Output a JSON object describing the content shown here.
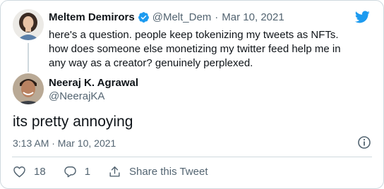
{
  "original_tweet": {
    "name": "Meltem Demirors",
    "handle": "@Melt_Dem",
    "separator": "·",
    "date": "Mar 10, 2021",
    "text_lines": [
      "here's a question. people keep tokenizing my tweets as NFTs.",
      "how does someone else monetizing my twitter feed help me in",
      "any way as a creator? genuinely perplexed."
    ]
  },
  "reply_tweet": {
    "name": "Neeraj K. Agrawal",
    "handle": "@NeerajKA",
    "text": "its pretty annoying",
    "timestamp": "3:13 AM · Mar 10, 2021"
  },
  "actions": {
    "likes": "18",
    "replies": "1",
    "share_label": "Share this Tweet"
  },
  "icons": {
    "brand": "twitter-bird-icon",
    "verified": "verified-badge-icon",
    "info": "info-icon",
    "like": "heart-icon",
    "reply": "reply-icon",
    "share": "share-icon"
  },
  "colors": {
    "twitter_blue": "#1d9bf0",
    "secondary_text": "#536471",
    "border": "#cfd9de"
  }
}
